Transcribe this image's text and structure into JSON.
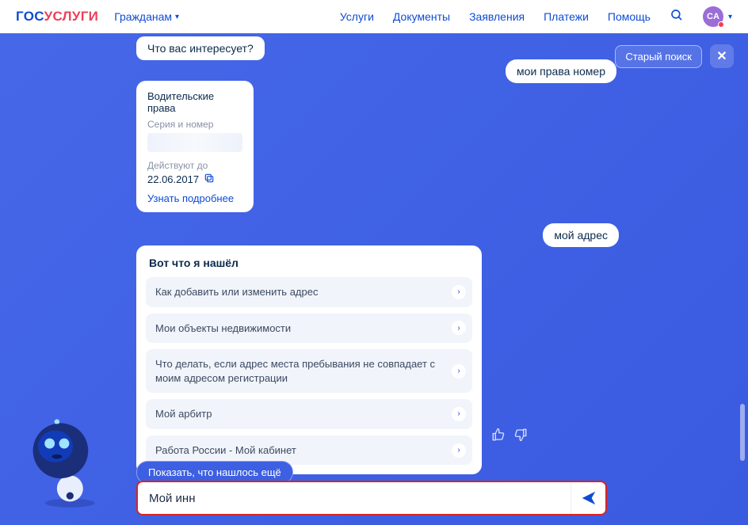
{
  "header": {
    "logo_part1": "ГОС",
    "logo_part2": "УСЛУГИ",
    "audience": "Гражданам",
    "nav": [
      "Услуги",
      "Документы",
      "Заявления",
      "Платежи",
      "Помощь"
    ],
    "avatar_initials": "CA"
  },
  "controls": {
    "old_search": "Старый поиск"
  },
  "chat": {
    "prompt": "Что вас интересует?",
    "user_messages": [
      "мои права номер",
      "мой адрес"
    ],
    "license_card": {
      "title": "Водительские права",
      "label_series": "Серия и номер",
      "label_valid": "Действуют до",
      "valid_until": "22.06.2017",
      "more": "Узнать подробнее"
    },
    "results_heading": "Вот что я нашёл",
    "results": [
      "Как добавить или изменить адрес",
      "Мои объекты недвижимости",
      "Что делать, если адрес места пребывания не совпадает с моим адресом регистрации",
      "Мой арбитр",
      "Работа России - Мой кабинет"
    ],
    "show_more": "Показать, что нашлось ещё",
    "input_value": "Мой инн"
  }
}
